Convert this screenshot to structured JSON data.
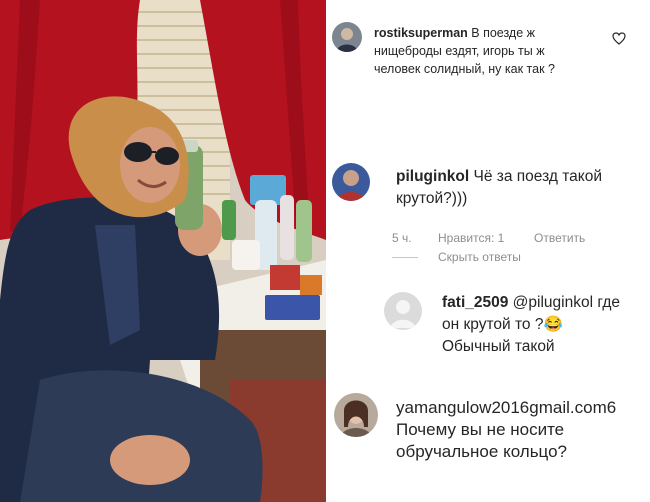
{
  "comments": [
    {
      "username": "rostiksuperman",
      "text_line1": "В поезде ж",
      "text_line2": "нищеброды ездят, игорь ты ж",
      "text_line3": "человек солидный, ну как так ?",
      "avatar_icon": "user-photo-avatar-icon",
      "like_icon": "heart-outline-icon"
    },
    {
      "username": "piluginkol",
      "text_line1": "Чё за поезд такой",
      "text_line2": "крутой?)))",
      "time": "5 ч.",
      "likes": "Нравится: 1",
      "reply": "Ответить",
      "hide_replies": "Скрыть ответы",
      "avatar_icon": "user-photo-avatar-icon"
    },
    {
      "username": "fati_2509",
      "mention": "@piluginkol",
      "text_after_mention": "где",
      "text_line2": "он крутой то ?😂",
      "text_line3": "Обычный такой",
      "avatar_icon": "default-user-avatar-icon"
    },
    {
      "username": "yamangulow2016gmail.com6",
      "text_line1": "Почему вы не носите",
      "text_line2": "обручальное кольцо?",
      "avatar_icon": "user-photo-avatar-icon"
    }
  ],
  "colors": {
    "text": "#262626",
    "meta": "#8e8e8e",
    "divider": "#c7c7c7",
    "curtain": "#b5121f"
  }
}
